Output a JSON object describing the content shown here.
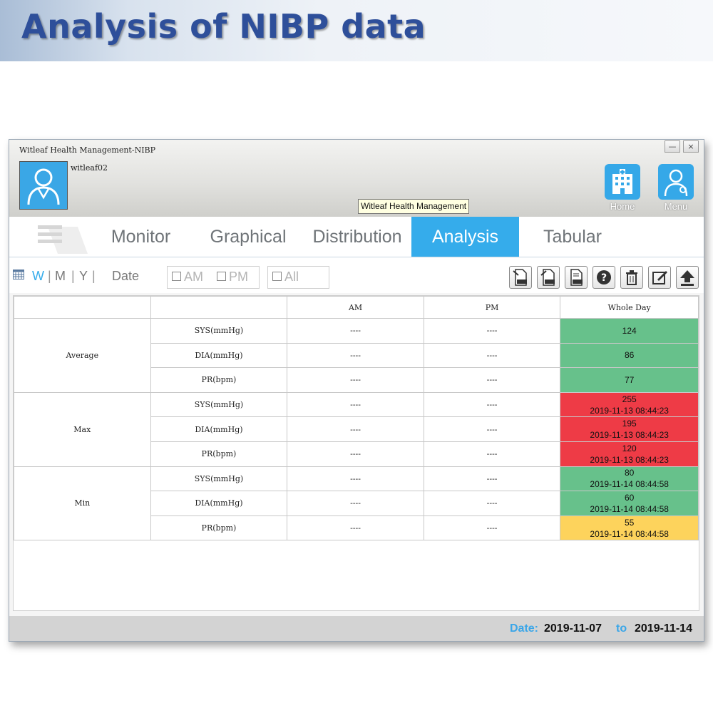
{
  "banner": {
    "title": "Analysis of NIBP data"
  },
  "window": {
    "title": "Witleaf Health Management-NIBP",
    "minimize": "—",
    "close": "×",
    "username": "witleaf02",
    "tooltip": "Witleaf Health Management",
    "home_label": "Home",
    "menu_label": "Menu"
  },
  "tabs": [
    {
      "label": "Monitor",
      "active": false
    },
    {
      "label": "Graphical",
      "active": false
    },
    {
      "label": "Distribution",
      "active": false
    },
    {
      "label": "Analysis",
      "active": true
    },
    {
      "label": "Tabular",
      "active": false
    }
  ],
  "filters": {
    "week": "W",
    "month": "M",
    "year": "Y",
    "sep": "|",
    "date": "Date",
    "am": "AM",
    "pm": "PM",
    "all": "All"
  },
  "toolbar_icons": [
    "export-dat-icon",
    "export-dat-icon",
    "export-pdf-icon",
    "help-icon",
    "trash-icon",
    "edit-icon",
    "upload-icon"
  ],
  "table": {
    "headers": [
      "",
      "",
      "AM",
      "PM",
      "Whole Day"
    ],
    "groups": [
      {
        "name": "Average",
        "rows": [
          {
            "param": "SYS(mmHg)",
            "am": "----",
            "pm": "----",
            "day": "124",
            "time": "",
            "status": "green"
          },
          {
            "param": "DIA(mmHg)",
            "am": "----",
            "pm": "----",
            "day": "86",
            "time": "",
            "status": "green"
          },
          {
            "param": "PR(bpm)",
            "am": "----",
            "pm": "----",
            "day": "77",
            "time": "",
            "status": "green"
          }
        ]
      },
      {
        "name": "Max",
        "rows": [
          {
            "param": "SYS(mmHg)",
            "am": "----",
            "pm": "----",
            "day": "255",
            "time": "2019-11-13 08:44:23",
            "status": "red"
          },
          {
            "param": "DIA(mmHg)",
            "am": "----",
            "pm": "----",
            "day": "195",
            "time": "2019-11-13 08:44:23",
            "status": "red"
          },
          {
            "param": "PR(bpm)",
            "am": "----",
            "pm": "----",
            "day": "120",
            "time": "2019-11-13 08:44:23",
            "status": "red"
          }
        ]
      },
      {
        "name": "Min",
        "rows": [
          {
            "param": "SYS(mmHg)",
            "am": "----",
            "pm": "----",
            "day": "80",
            "time": "2019-11-14 08:44:58",
            "status": "green"
          },
          {
            "param": "DIA(mmHg)",
            "am": "----",
            "pm": "----",
            "day": "60",
            "time": "2019-11-14 08:44:58",
            "status": "green"
          },
          {
            "param": "PR(bpm)",
            "am": "----",
            "pm": "----",
            "day": "55",
            "time": "2019-11-14 08:44:58",
            "status": "yellow"
          }
        ]
      }
    ]
  },
  "status": {
    "date_label": "Date:",
    "from": "2019-11-07",
    "to_label": "to",
    "to": "2019-11-14"
  },
  "colors": {
    "accent": "#35aceb",
    "banner_title": "#2e4f9a",
    "normal": "#67c18b",
    "high": "#ee3b46",
    "low": "#fdd35c",
    "date_label": "#3aa6e8"
  }
}
